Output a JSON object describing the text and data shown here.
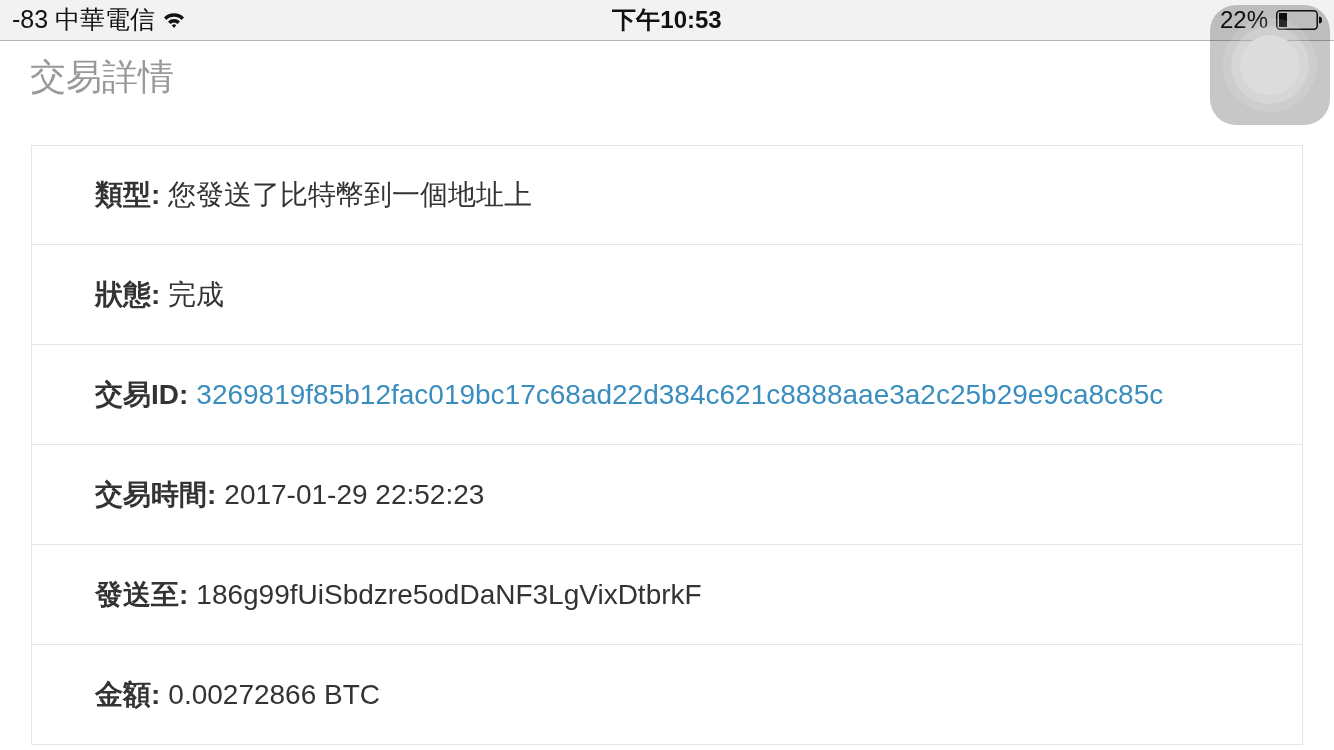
{
  "status_bar": {
    "carrier": "-83 中華電信",
    "time": "下午10:53",
    "battery": "22%"
  },
  "title": "交易詳情",
  "details": [
    {
      "kind": "text",
      "label": "類型:",
      "value": "您發送了比特幣到一個地址上"
    },
    {
      "kind": "text",
      "label": "狀態:",
      "value": "完成"
    },
    {
      "kind": "link",
      "label": "交易ID:",
      "value": "3269819f85b12fac019bc17c68ad22d384c621c8888aae3a2c25b29e9ca8c85c"
    },
    {
      "kind": "text",
      "label": "交易時間:",
      "value": "2017-01-29 22:52:23"
    },
    {
      "kind": "text",
      "label": "發送至:",
      "value": "186g99fUiSbdzre5odDaNF3LgVixDtbrkF"
    },
    {
      "kind": "text",
      "label": "金額:",
      "value": "0.00272866 BTC"
    }
  ]
}
